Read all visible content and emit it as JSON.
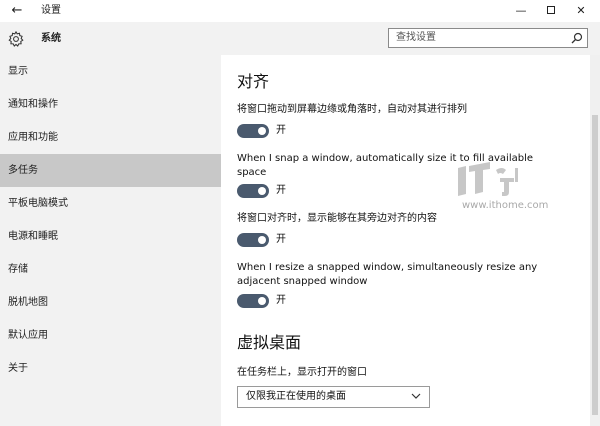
{
  "window": {
    "back_label": "←",
    "title": "设置",
    "min_label": "—",
    "close_label": "✕"
  },
  "sidebar": {
    "section_title": "系统",
    "items": [
      {
        "label": "显示"
      },
      {
        "label": "通知和操作"
      },
      {
        "label": "应用和功能"
      },
      {
        "label": "多任务",
        "active": true
      },
      {
        "label": "平板电脑模式"
      },
      {
        "label": "电源和睡眠"
      },
      {
        "label": "存储"
      },
      {
        "label": "脱机地图"
      },
      {
        "label": "默认应用"
      },
      {
        "label": "关于"
      }
    ]
  },
  "search": {
    "placeholder": "查找设置"
  },
  "snap": {
    "heading": "对齐",
    "settings": [
      {
        "description": "将窗口拖动到屏幕边缘或角落时，自动对其进行排列",
        "toggle_state": "开",
        "on": true
      },
      {
        "description": "When I snap a window, automatically size it to fill available space",
        "toggle_state": "开",
        "on": true
      },
      {
        "description": "将窗口对齐时，显示能够在其旁边对齐的内容",
        "toggle_state": "开",
        "on": true
      },
      {
        "description": "When I resize a snapped window, simultaneously resize any adjacent snapped window",
        "toggle_state": "开",
        "on": true
      }
    ]
  },
  "virtual_desktops": {
    "heading": "虚拟桌面",
    "label": "在任务栏上，显示打开的窗口",
    "selected": "仅限我正在使用的桌面"
  },
  "watermark": {
    "url": "www.ithome.com"
  },
  "colors": {
    "toggle_on": "#4a5a6e",
    "sidebar_bg": "#f2f2f2",
    "active_item_bg": "#c8c8c8"
  }
}
